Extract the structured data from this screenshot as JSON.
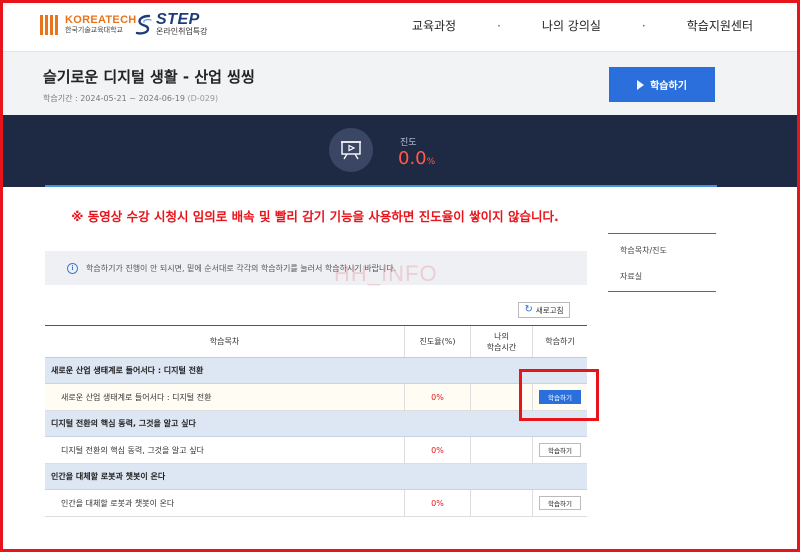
{
  "header": {
    "korea_tech_name": "KOREATECH",
    "korea_tech_sub": "한국기술교육대학교",
    "step_name": "STEP",
    "step_sub": "온라인취업특강",
    "nav": [
      {
        "label": "교육과정"
      },
      {
        "label": "나의 강의실"
      },
      {
        "label": "학습지원센터"
      }
    ],
    "nav_separator": "·"
  },
  "course": {
    "title": "슬기로운 디지털 생활 - 산업 씽씽",
    "period_label": "학습기간 : 2024-05-21 ~ 2024-06-19",
    "dday": "(D-029)",
    "study_button": "학습하기"
  },
  "progress": {
    "label": "진도",
    "value": "0.0",
    "unit": "%"
  },
  "notice": "※ 동영상 수강 시청시 임의로 배속 및 빨리 감기 기능을 사용하면 진도율이 쌓이지 않습니다.",
  "sidebar": {
    "items": [
      {
        "label": "학습목차/진도"
      },
      {
        "label": "자료실"
      }
    ]
  },
  "info_text": "학습하기가 진행이 안 되시면, 밑에 순서대로 각각의 학습하기를 눌러서 학습하시기 바랍니다.",
  "watermark": "HH_INFO",
  "refresh_label": "새로고침",
  "table": {
    "headers": [
      "학습목차",
      "진도율(%)",
      "나의\n학습시간",
      "학습하기"
    ],
    "header_my_time_1": "나의",
    "header_my_time_2": "학습시간",
    "sections": [
      {
        "title": "새로운 산업 생태계로 들어서다 : 디지털 전환",
        "lesson": "새로운 산업 생태계로 들어서다 : 디지털 전환",
        "progress": "0%",
        "time": "",
        "button": "학습하기",
        "active": true
      },
      {
        "title": "디지털 전환의 핵심 동력, 그것을 알고 싶다",
        "lesson": "디지털 전환의 핵심 동력, 그것을 알고 싶다",
        "progress": "0%",
        "time": "",
        "button": "학습하기",
        "active": false
      },
      {
        "title": "인간을 대체할 로봇과 챗봇이 온다",
        "lesson": "인간을 대체할 로봇과 챗봇이 온다",
        "progress": "0%",
        "time": "",
        "button": "학습하기",
        "active": false
      }
    ]
  },
  "colors": {
    "accent_blue": "#2a6fdb",
    "alert_red": "#e8141b",
    "progress_band": "#1e2a44"
  },
  "icons": {
    "info": "info-icon",
    "refresh": "refresh-icon",
    "board": "presentation-board-icon",
    "play": "play-icon"
  }
}
